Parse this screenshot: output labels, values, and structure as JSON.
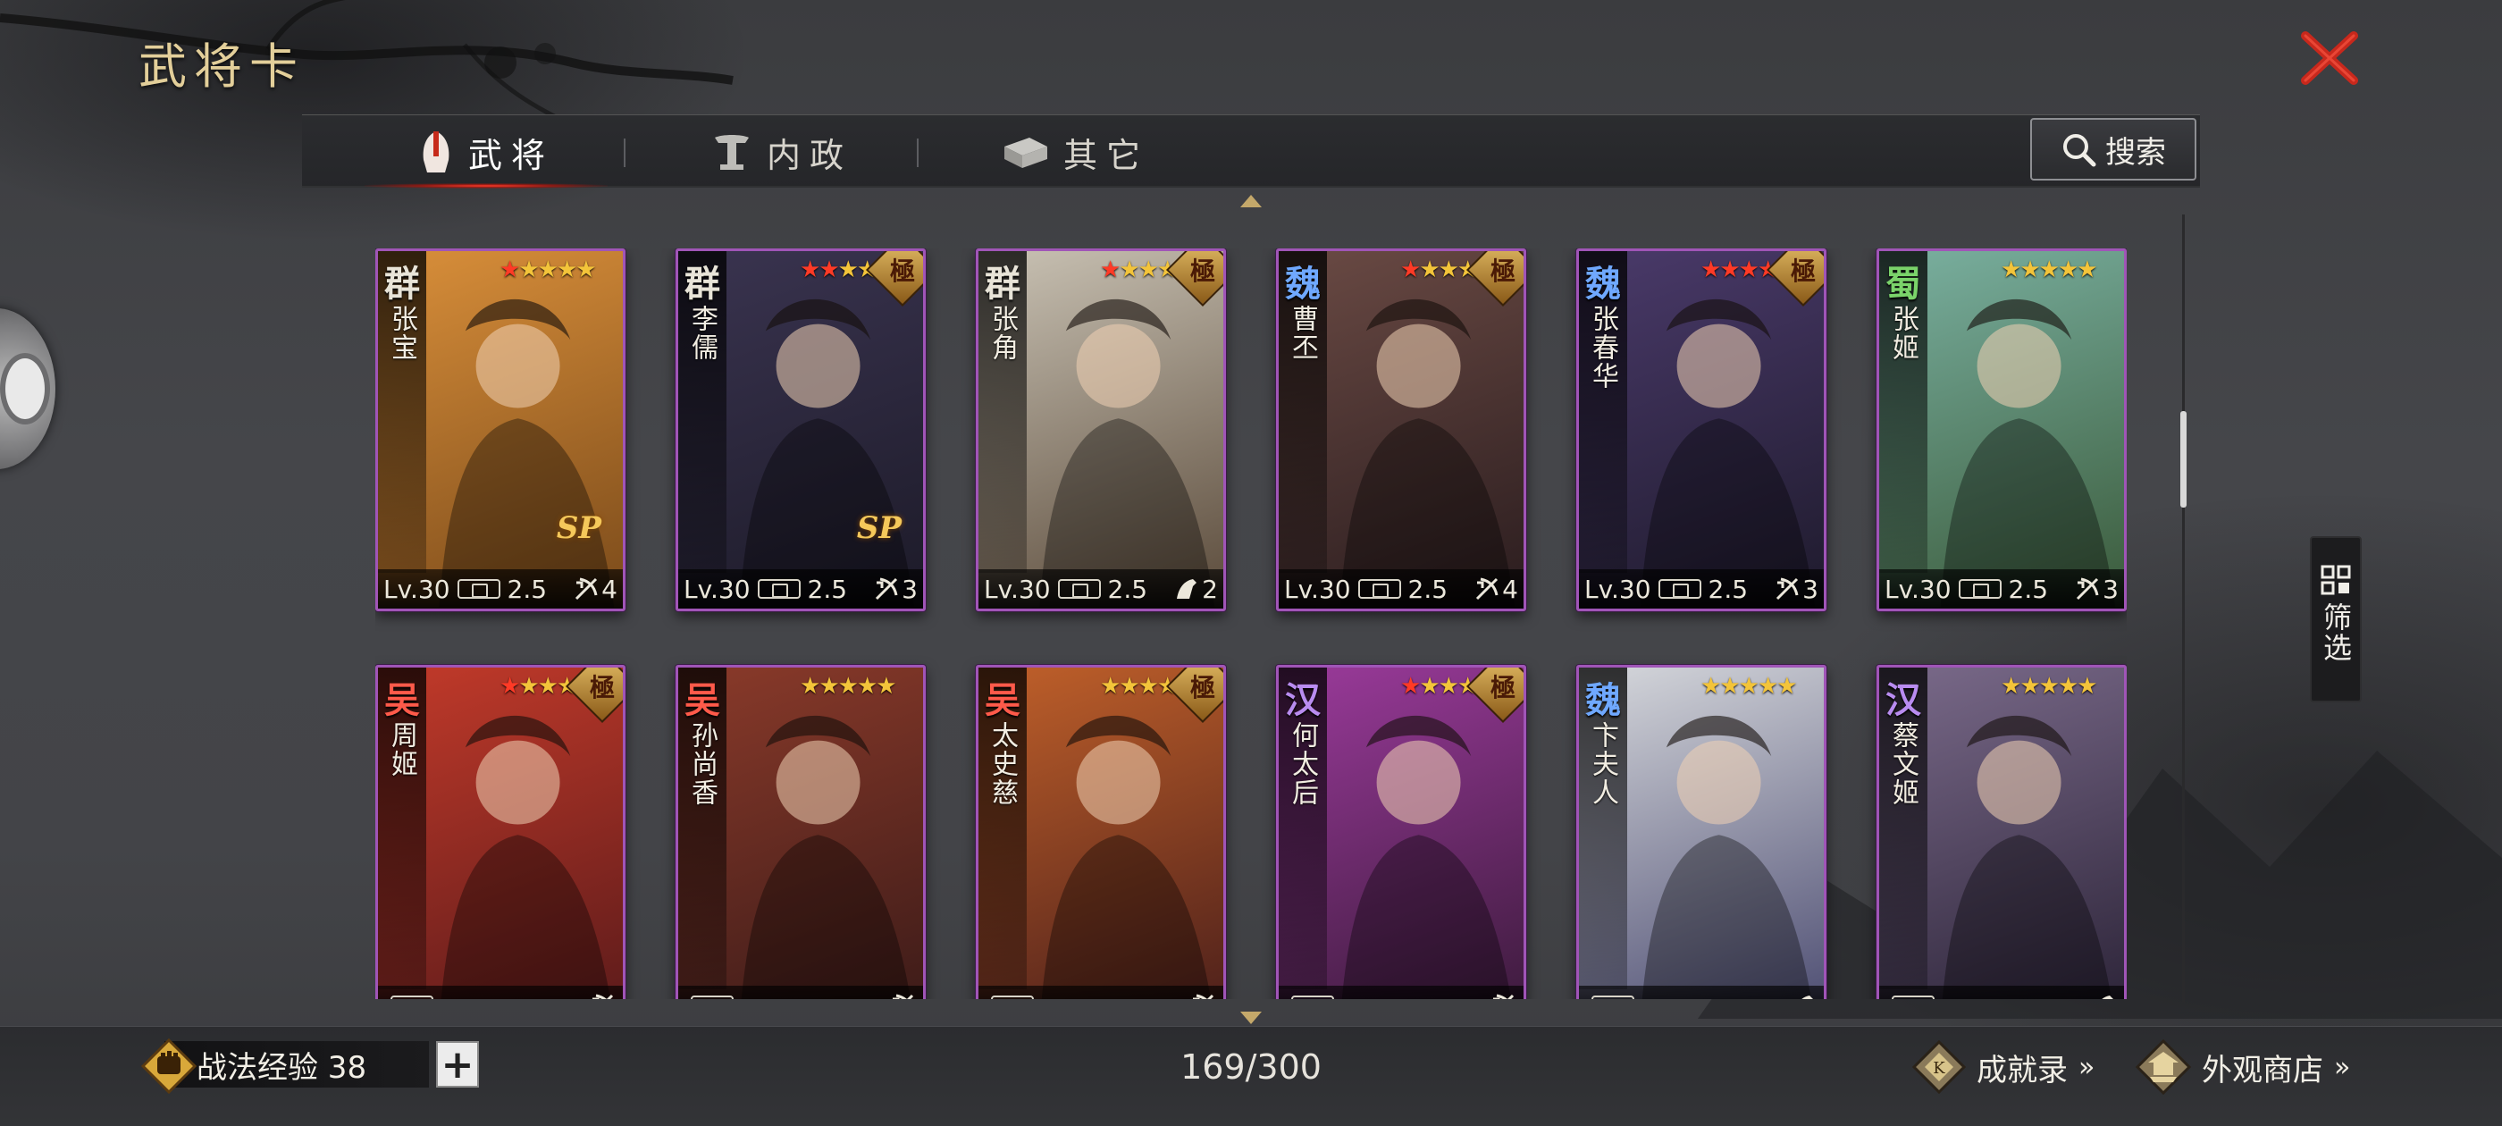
{
  "title": "武将卡",
  "tabs": [
    {
      "label": "武将",
      "icon": "helmet-icon",
      "active": true
    },
    {
      "label": "内政",
      "icon": "pillar-icon",
      "active": false
    },
    {
      "label": "其它",
      "icon": "scroll-box-icon",
      "active": false
    }
  ],
  "search": {
    "label": "搜索"
  },
  "filter": {
    "label": "筛选"
  },
  "cards": [
    {
      "faction": "群",
      "faction_color": "#e8e4d8",
      "name": "张宝",
      "stars_red": 1,
      "ji": false,
      "level": "Lv.30",
      "cost": "2.5",
      "unit": "4",
      "unit_icon": "bow-icon",
      "sp": "SP",
      "bg": [
        "#d98f3a",
        "#7a4a1a"
      ]
    },
    {
      "faction": "群",
      "faction_color": "#e8e4d8",
      "name": "李儒",
      "stars_red": 2,
      "ji": true,
      "level": "Lv.30",
      "cost": "2.5",
      "unit": "3",
      "unit_icon": "bow-icon",
      "sp": "SP",
      "bg": [
        "#3a3450",
        "#1c1a28"
      ]
    },
    {
      "faction": "群",
      "faction_color": "#e8e4d8",
      "name": "张角",
      "stars_red": 1,
      "ji": true,
      "level": "Lv.30",
      "cost": "2.5",
      "unit": "2",
      "unit_icon": "horse-icon",
      "sp": "",
      "bg": [
        "#c9c2b4",
        "#5a4a3a"
      ]
    },
    {
      "faction": "魏",
      "faction_color": "#6fa8ff",
      "name": "曹丕",
      "stars_red": 1,
      "ji": true,
      "level": "Lv.30",
      "cost": "2.5",
      "unit": "4",
      "unit_icon": "bow-icon",
      "sp": "",
      "bg": [
        "#6a4a44",
        "#2a1c1e"
      ]
    },
    {
      "faction": "魏",
      "faction_color": "#6fa8ff",
      "name": "张春华",
      "stars_red": 4,
      "ji": true,
      "level": "Lv.30",
      "cost": "2.5",
      "unit": "3",
      "unit_icon": "bow-icon",
      "sp": "",
      "bg": [
        "#4a3a6a",
        "#1e1a2c"
      ]
    },
    {
      "faction": "蜀",
      "faction_color": "#7ad36a",
      "name": "张姬",
      "stars_red": 0,
      "ji": false,
      "level": "Lv.30",
      "cost": "2.5",
      "unit": "3",
      "unit_icon": "bow-icon",
      "sp": "",
      "bg": [
        "#7ab0a0",
        "#3a5a3a"
      ]
    },
    {
      "faction": "吴",
      "faction_color": "#ff5a4a",
      "name": "周姬",
      "stars_red": 1,
      "ji": true,
      "level": "",
      "cost": "",
      "unit": "",
      "unit_icon": "bow-icon",
      "sp": "",
      "bg": [
        "#c23a2a",
        "#5a1a1a"
      ]
    },
    {
      "faction": "吴",
      "faction_color": "#ff5a4a",
      "name": "孙尚香",
      "stars_red": 0,
      "ji": false,
      "level": "",
      "cost": "",
      "unit": "",
      "unit_icon": "bow-icon",
      "sp": "",
      "bg": [
        "#8a3a2a",
        "#3a1a18"
      ]
    },
    {
      "faction": "吴",
      "faction_color": "#ff5a4a",
      "name": "太史慈",
      "stars_red": 0,
      "ji": true,
      "level": "",
      "cost": "",
      "unit": "",
      "unit_icon": "bow-icon",
      "sp": "",
      "bg": [
        "#c0602a",
        "#4a1e1a"
      ]
    },
    {
      "faction": "汉",
      "faction_color": "#b98cf0",
      "name": "何太后",
      "stars_red": 1,
      "ji": true,
      "level": "",
      "cost": "",
      "unit": "",
      "unit_icon": "bow-icon",
      "sp": "",
      "bg": [
        "#9a3a9a",
        "#3a1a3a"
      ]
    },
    {
      "faction": "魏",
      "faction_color": "#6fa8ff",
      "name": "卞夫人",
      "stars_red": 0,
      "ji": false,
      "level": "",
      "cost": "",
      "unit": "",
      "unit_icon": "horse-icon",
      "sp": "",
      "bg": [
        "#d6d8dc",
        "#4a4a70"
      ]
    },
    {
      "faction": "汉",
      "faction_color": "#b98cf0",
      "name": "蔡文姬",
      "stars_red": 0,
      "ji": false,
      "level": "",
      "cost": "",
      "unit": "",
      "unit_icon": "horse-icon",
      "sp": "",
      "bg": [
        "#7a6a8a",
        "#2a2236"
      ]
    }
  ],
  "ji_label": "極",
  "bottom": {
    "exp_label": "战法经验 38",
    "plus": "+",
    "page_count": "169/300",
    "achievements": "成就录",
    "shop": "外观商店",
    "chevron": "»"
  }
}
